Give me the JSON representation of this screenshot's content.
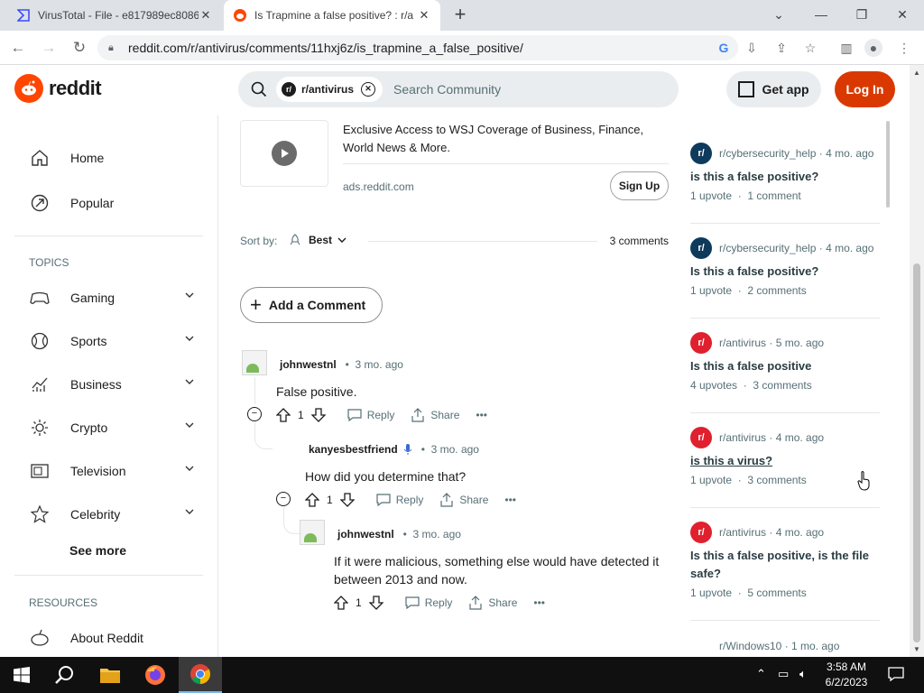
{
  "browser": {
    "tabs": [
      {
        "title": "VirusTotal - File - e817989ec8086",
        "active": false
      },
      {
        "title": "Is Trapmine a false positive? : r/a",
        "active": true
      }
    ],
    "new_tab": "+",
    "url": "reddit.com/r/antivirus/comments/11hxj6z/is_trapmine_a_false_positive/"
  },
  "header": {
    "logo_text": "reddit",
    "search_chip": "r/antivirus",
    "search_placeholder": "Search Community",
    "get_app": "Get app",
    "login": "Log In"
  },
  "sidebar": {
    "home": "Home",
    "popular": "Popular",
    "topics_header": "TOPICS",
    "topics": [
      "Gaming",
      "Sports",
      "Business",
      "Crypto",
      "Television",
      "Celebrity"
    ],
    "see_more": "See more",
    "resources_header": "RESOURCES",
    "about": "About Reddit"
  },
  "ad": {
    "text": "Exclusive Access to WSJ Coverage of Business, Finance, World News & More.",
    "domain": "ads.reddit.com",
    "cta": "Sign Up"
  },
  "sort": {
    "label": "Sort by:",
    "value": "Best",
    "count": "3 comments"
  },
  "add_comment": "Add a Comment",
  "comments": [
    {
      "author": "johnwestnl",
      "time": "3 mo. ago",
      "text": "False positive.",
      "votes": "1",
      "reply": "Reply",
      "share": "Share"
    },
    {
      "author": "kanyesbestfriend",
      "time": "3 mo. ago",
      "text": "How did you determine that?",
      "votes": "1",
      "reply": "Reply",
      "share": "Share"
    },
    {
      "author": "johnwestnl",
      "time": "3 mo. ago",
      "text": "If it were malicious, something else would have detected it between 2013 and now.",
      "votes": "1",
      "reply": "Reply",
      "share": "Share"
    }
  ],
  "related": [
    {
      "sub": "r/cybersecurity_help",
      "time": "4 mo. ago",
      "title": "is this a false positive?",
      "upvotes": "1 upvote",
      "comments": "1 comment",
      "color": "#0e3a5c"
    },
    {
      "sub": "r/cybersecurity_help",
      "time": "4 mo. ago",
      "title": "Is this a false positive?",
      "upvotes": "1 upvote",
      "comments": "2 comments",
      "color": "#0e3a5c"
    },
    {
      "sub": "r/antivirus",
      "time": "5 mo. ago",
      "title": "Is this a false positive",
      "upvotes": "4 upvotes",
      "comments": "3 comments",
      "color": "#e0202e"
    },
    {
      "sub": "r/antivirus",
      "time": "4 mo. ago",
      "title": "is this a virus?",
      "upvotes": "1 upvote",
      "comments": "3 comments",
      "color": "#e0202e"
    },
    {
      "sub": "r/antivirus",
      "time": "4 mo. ago",
      "title": "Is this a false positive, is the file safe?",
      "upvotes": "1 upvote",
      "comments": "5 comments",
      "color": "#e0202e"
    },
    {
      "sub": "r/Windows10",
      "time": "1 mo. ago"
    }
  ],
  "taskbar": {
    "time": "3:58 AM",
    "date": "6/2/2023"
  },
  "colors": {
    "reddit_orange": "#ff4500",
    "login_red": "#d93900"
  }
}
